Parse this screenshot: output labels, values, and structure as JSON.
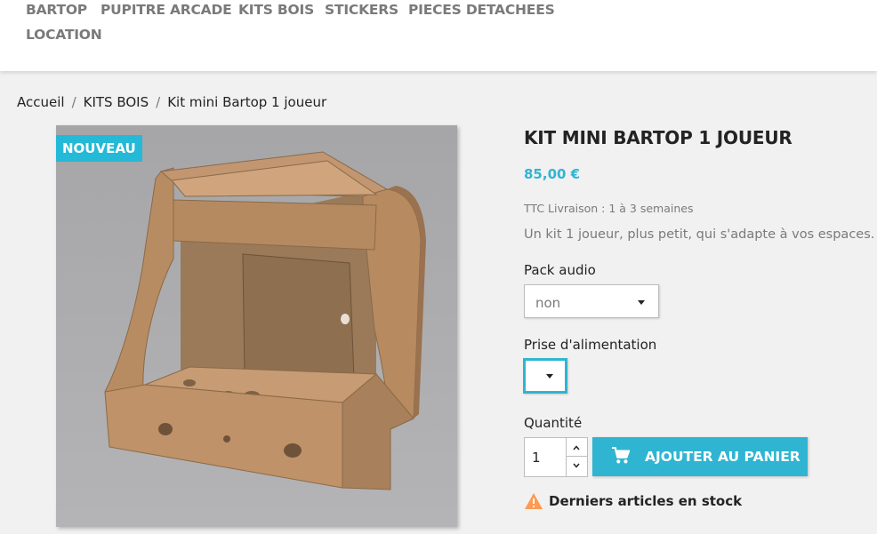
{
  "nav": {
    "items": [
      "BARTOP",
      "PUPITRE ARCADE",
      "KITS BOIS",
      "STICKERS",
      "PIECES DETACHEES",
      "LOCATION"
    ]
  },
  "breadcrumb": [
    "Accueil",
    "KITS BOIS",
    "Kit mini Bartop 1 joueur"
  ],
  "product": {
    "badge": "NOUVEAU",
    "title": "KIT MINI BARTOP 1 JOUEUR",
    "price": "85,00 €",
    "tax_info": "TTC Livraison : 1 à 3 semaines",
    "summary": "Un kit 1 joueur, plus petit, qui s'adapte à vos espaces.",
    "image_icon": "arcade-cabinet-kit-image"
  },
  "options": {
    "audio_label": "Pack audio",
    "audio_value": "non",
    "power_label": "Prise d'alimentation",
    "power_value": ""
  },
  "quantity": {
    "label": "Quantité",
    "value": "1"
  },
  "cart": {
    "button_label": "AJOUTER AU PANIER",
    "icon": "shopping-cart-icon"
  },
  "stock": {
    "message": "Derniers articles en stock",
    "icon": "warning-icon"
  },
  "colors": {
    "accent": "#2fb5d2",
    "badge": "#24b9d7",
    "warning": "#ff9a52"
  }
}
